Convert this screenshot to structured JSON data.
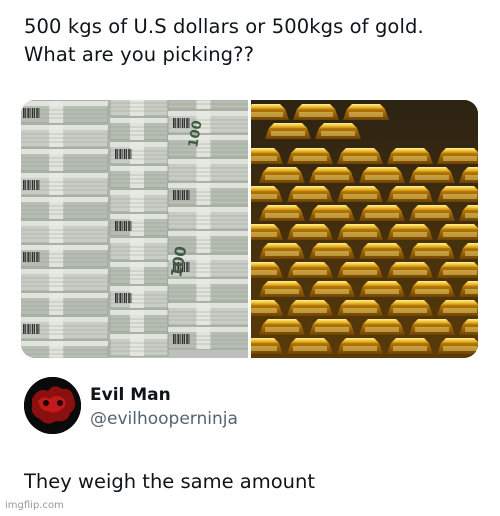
{
  "post": {
    "line1": "500 kgs of U.S dollars  or   500kgs of gold.",
    "line2": "What are you picking??"
  },
  "media": {
    "money_image": "stacks-of-100-dollar-bills",
    "gold_image": "stacked-gold-bars",
    "money_band_text": "100"
  },
  "reply": {
    "display_name": "Evil Man",
    "handle": "@evilhooperninja",
    "text": "They weigh the same amount"
  },
  "watermark": "imgflip.com",
  "colors": {
    "text": "#0f1419",
    "handle": "#536471",
    "gold": "#e2b422",
    "cash": "#b9c0b6",
    "avatar_red": "#8b0f0f"
  }
}
